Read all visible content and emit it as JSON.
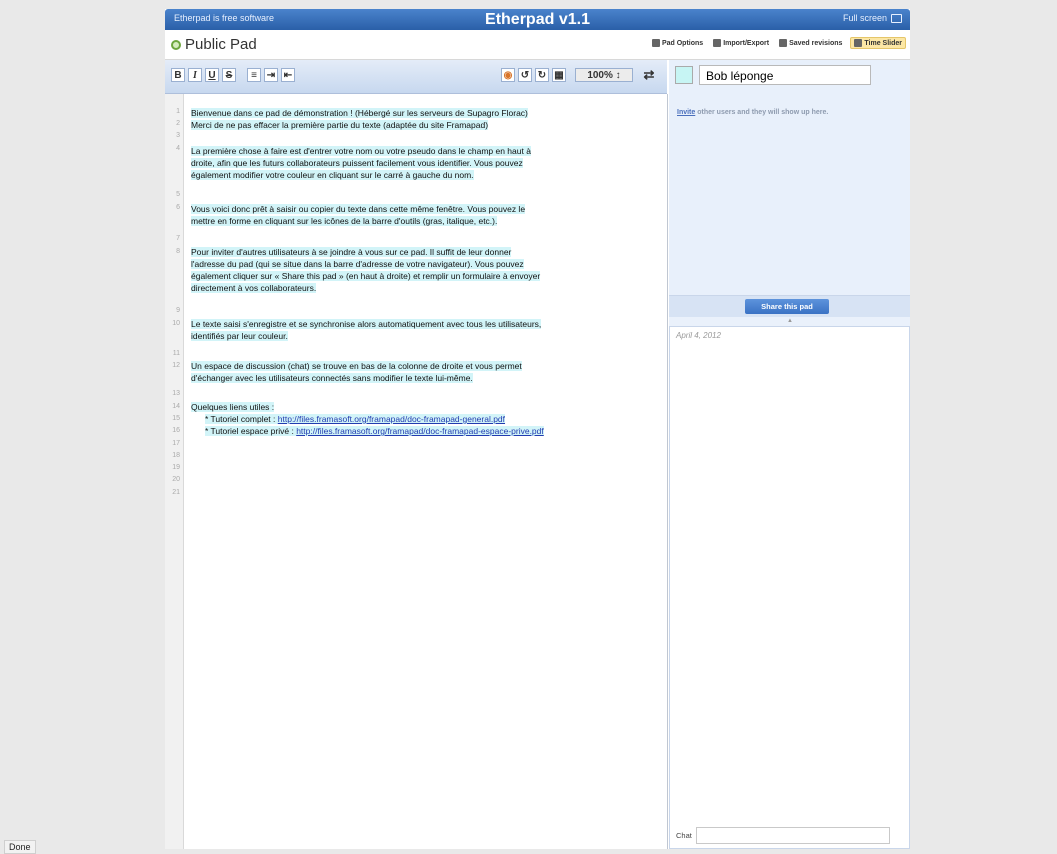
{
  "header": {
    "free_software": "Etherpad is free software",
    "title": "Etherpad v1.1",
    "fullscreen": "Full screen"
  },
  "pad": {
    "name": "Public Pad",
    "options": [
      "Pad Options",
      "Import/Export",
      "Saved revisions",
      "Time Slider"
    ]
  },
  "toolbar": {
    "bold": "B",
    "italic": "I",
    "underline": "U",
    "strike": "S",
    "zoom": "100%",
    "zoom_arrow": "↕"
  },
  "editor": {
    "line_numbers": [
      "1",
      "2",
      "3",
      "4",
      "5",
      "6",
      "7",
      "8",
      "9",
      "10",
      "11",
      "12",
      "13",
      "14",
      "15",
      "16",
      "17",
      "18",
      "19",
      "20",
      "21"
    ],
    "lines": {
      "l1": "Bienvenue dans ce pad de démonstration ! (Hébergé sur les serveurs de Supagro Florac)",
      "l2": "Merci de ne pas effacer la première partie du texte (adaptée du site Framapad)",
      "l4a": "La  première chose à faire est d'entrer votre nom ou votre pseudo dans le  champ en haut à",
      "l4b": "droite, afin que les futurs collaborateurs puissent  facilement vous identifier. Vous pouvez",
      "l4c": "également modifier votre couleur en cliquant sur le carré à gauche du nom.",
      "l6a": "Vous voici donc prêt à saisir ou copier du texte dans cette même fenêtre.  Vous pouvez le",
      "l6b": "mettre en forme en cliquant sur les icônes de la barre  d'outils (gras, italique, etc.).",
      "l8a": "Pour  inviter d'autres utilisateurs à se joindre à vous sur ce pad. Il suffit  de leur donner",
      "l8b": "l'adresse du pad (qui se situe dans la barre d'adresse  de votre navigateur). Vous pouvez",
      "l8c": "également cliquer sur « Share this pad » (en  haut à droite) et remplir un formulaire à envoyer",
      "l8d": "directement à vos  collaborateurs.",
      "l10a": "Le texte saisi s'enregistre et se synchronise alors automatiquement avec tous les utilisateurs,",
      "l10b": "identifiés par leur couleur.",
      "l12a": "Un espace de discussion (chat) se trouve en bas de la colonne de droite et vous  permet",
      "l12b": "d'échanger avec les utilisateurs connectés sans modifier le texte  lui-même.",
      "l14": "Quelques liens utiles :",
      "l15_prefix": "* Tutoriel complet : ",
      "l15_link": "http://files.framasoft.org/framapad/doc-framapad-general.pdf",
      "l16_prefix": "* Tutoriel espace privé : ",
      "l16_link": "http://files.framasoft.org/framapad/doc-framapad-espace-prive.pdf"
    }
  },
  "sidebar": {
    "username": "Bob léponge",
    "invite_link": "Invite",
    "invite_text": " other users and they will show up here.",
    "share_button": "Share this pad",
    "date": "April 4, 2012",
    "chat_label": "Chat"
  },
  "status": {
    "done": "Done"
  }
}
